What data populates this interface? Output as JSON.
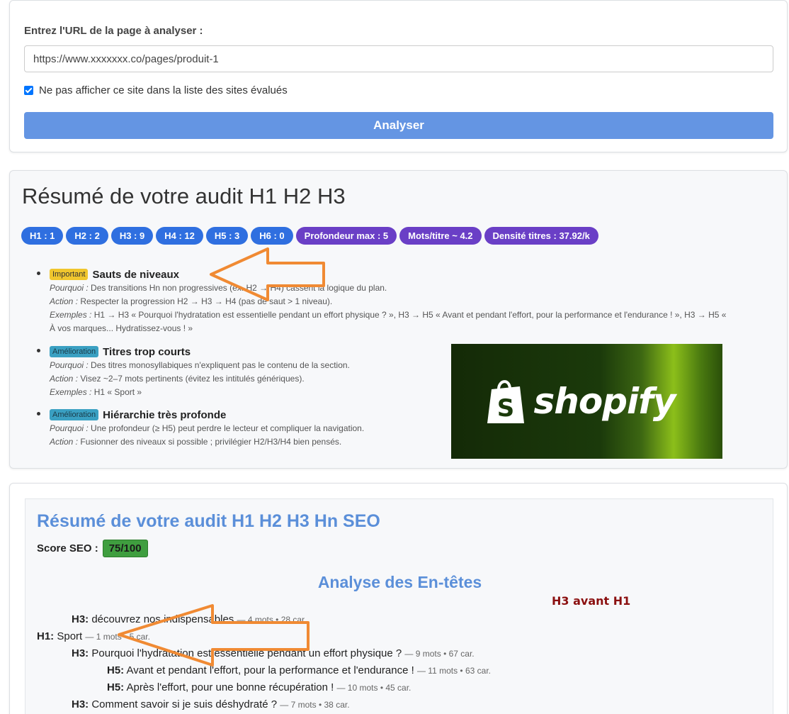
{
  "form": {
    "label": "Entrez l'URL de la page à analyser :",
    "url_value": "https://www.xxxxxxx.co/pages/produit-1",
    "checkbox_label": "Ne pas afficher ce site dans la liste des sites évalués",
    "checkbox_checked": true,
    "analyze_label": "Analyser"
  },
  "summary": {
    "title": "Résumé de votre audit H1 H2 H3",
    "badges": [
      {
        "label": "H1 : 1",
        "color": "#2f6fe0"
      },
      {
        "label": "H2 : 2",
        "color": "#2f6fe0"
      },
      {
        "label": "H3 : 9",
        "color": "#2f6fe0"
      },
      {
        "label": "H4 : 12",
        "color": "#2f6fe0"
      },
      {
        "label": "H5 : 3",
        "color": "#2f6fe0"
      },
      {
        "label": "H6 : 0",
        "color": "#2f6fe0"
      },
      {
        "label": "Profondeur max : 5",
        "color": "#6a3fc6"
      },
      {
        "label": "Mots/titre ~ 4.2",
        "color": "#6a3fc6"
      },
      {
        "label": "Densité titres : 37.92/k",
        "color": "#6a3fc6"
      }
    ],
    "issues": [
      {
        "tag": "Important",
        "title": "Sauts de niveaux",
        "pourquoi_label": "Pourquoi :",
        "pourquoi": "Des transitions Hn non progressives (ex. H2 → H4) cassent la logique du plan.",
        "action_label": "Action :",
        "action": "Respecter la progression H2 → H3 → H4 (pas de saut > 1 niveau).",
        "exemples_label": "Exemples :",
        "exemples": "H1 → H3 « Pourquoi l'hydratation est essentielle pendant un effort physique ? », H3 → H5 « Avant et pendant l'effort, pour la performance et l'endurance ! », H3 → H5 «",
        "exemples_2": "À vos marques... Hydratissez-vous ! »"
      },
      {
        "tag": "Amélioration",
        "title": "Titres trop courts",
        "pourquoi_label": "Pourquoi :",
        "pourquoi": "Des titres monosyllabiques n'expliquent pas le contenu de la section.",
        "action_label": "Action :",
        "action": "Visez ~2–7 mots pertinents (évitez les intitulés génériques).",
        "exemples_label": "Exemples :",
        "exemples": "H1 « Sport »"
      },
      {
        "tag": "Amélioration",
        "title": "Hiérarchie très profonde",
        "pourquoi_label": "Pourquoi :",
        "pourquoi": "Une profondeur (≥ H5) peut perdre le lecteur et compliquer la navigation.",
        "action_label": "Action :",
        "action": "Fusionner des niveaux si possible ; privilégier H2/H3/H4 bien pensés."
      }
    ],
    "image_text": "shopify"
  },
  "seo": {
    "title": "Résumé de votre audit H1 H2 H3 Hn SEO",
    "score_label": "Score SEO :",
    "score_value": "75/100",
    "headers_title": "Analyse des En-têtes",
    "warning": "H3 avant H1",
    "headings": [
      {
        "level": "H3:",
        "text": "découvrez nos indispensables",
        "meta": "— 4 mots • 28 car."
      },
      {
        "level": "H1:",
        "text": "Sport",
        "meta": "— 1 mots • 5 car."
      },
      {
        "level": "H3:",
        "text": "Pourquoi l'hydratation est essentielle pendant un effort physique ?",
        "meta": "— 9 mots • 67 car."
      },
      {
        "level": "H5:",
        "text": "Avant et pendant l'effort, pour la performance et l'endurance !",
        "meta": "— 11 mots • 63 car."
      },
      {
        "level": "H5:",
        "text": "Après l'effort, pour une bonne récupération !",
        "meta": "— 10 mots • 45 car."
      },
      {
        "level": "H3:",
        "text": "Comment savoir si je suis déshydraté ?",
        "meta": "— 7 mots • 38 car."
      }
    ]
  },
  "colors": {
    "accent": "#6495e3",
    "arrow": "#f08a33",
    "score_green": "#3f9e3f",
    "warning_red": "#8b1010"
  }
}
